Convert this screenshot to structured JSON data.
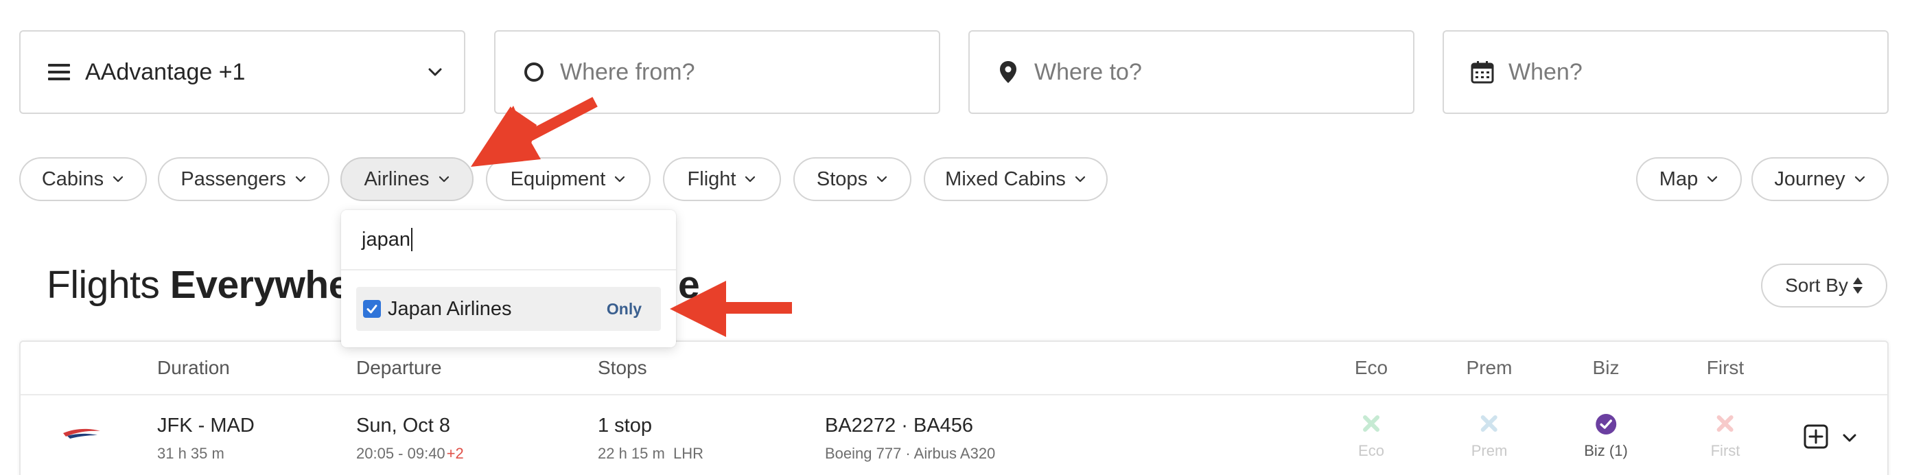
{
  "search": {
    "program": "AAdvantage +1",
    "from_placeholder": "Where from?",
    "to_placeholder": "Where to?",
    "when_placeholder": "When?"
  },
  "filters": [
    "Cabins",
    "Passengers",
    "Airlines",
    "Equipment",
    "Flight",
    "Stops",
    "Mixed Cabins"
  ],
  "view": {
    "map": "Map",
    "journey": "Journey"
  },
  "heading": {
    "light": "Flights ",
    "bold_visible": "Everywhe",
    "tail_visible": "e"
  },
  "sort_label": "Sort By",
  "airline_dropdown": {
    "search_value": "japan",
    "option_label": "Japan Airlines",
    "option_checked": true,
    "only_label": "Only"
  },
  "table": {
    "headers": {
      "duration": "Duration",
      "departure": "Departure",
      "stops": "Stops",
      "eco": "Eco",
      "prem": "Prem",
      "biz": "Biz",
      "first": "First"
    },
    "rows": [
      {
        "route": "JFK - MAD",
        "duration": "31 h 35 m",
        "date": "Sun, Oct 8",
        "times": "20:05 - 09:40",
        "day_offset": "+2",
        "stops": "1 stop",
        "layover": "22 h 15 m",
        "via": "LHR",
        "flights": "BA2272 · BA456",
        "aircraft": "Boeing 777 · Airbus A320",
        "cabins": {
          "eco": "Eco",
          "prem": "Prem",
          "biz": "Biz (1)",
          "first": "First"
        }
      }
    ]
  },
  "colors": {
    "accent_red": "#e8402a",
    "checkbox_blue": "#2f74d9",
    "only_link": "#3a5f8f",
    "biz_purple": "#6b3fa0",
    "eco_green": "#c6ead3",
    "prem_blue": "#cfe3ee",
    "first_red": "#f7caca"
  }
}
